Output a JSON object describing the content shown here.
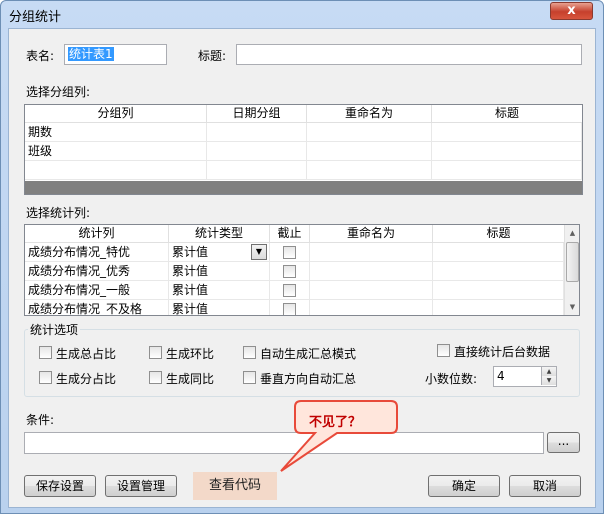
{
  "window": {
    "title": "分组统计",
    "close": "x"
  },
  "form": {
    "table_name_label": "表名:",
    "table_name_value": "统计表1",
    "title_label": "标题:",
    "title_value": ""
  },
  "group_section": {
    "label": "选择分组列:",
    "columns": [
      "分组列",
      "日期分组",
      "重命名为",
      "标题"
    ],
    "rows": [
      [
        "期数",
        "",
        "",
        ""
      ],
      [
        "班级",
        "",
        "",
        ""
      ],
      [
        "",
        "",
        "",
        ""
      ]
    ]
  },
  "stat_section": {
    "label": "选择统计列:",
    "columns": [
      "统计列",
      "统计类型",
      "截止",
      "重命名为",
      "标题"
    ],
    "rows": [
      [
        "成绩分布情况_特优",
        "累计值"
      ],
      [
        "成绩分布情况_优秀",
        "累计值"
      ],
      [
        "成绩分布情况_一般",
        "累计值"
      ],
      [
        "成绩分布情况_不及格",
        "累计值"
      ]
    ]
  },
  "options": {
    "label": "统计选项",
    "items": [
      "生成总占比",
      "生成环比",
      "自动生成汇总模式",
      "直接统计后台数据",
      "生成分占比",
      "生成同比",
      "垂直方向自动汇总"
    ],
    "decimals_label": "小数位数:",
    "decimals_value": "4"
  },
  "condition": {
    "label": "条件:",
    "value": "",
    "browse": "..."
  },
  "buttons": {
    "save": "保存设置",
    "manage": "设置管理",
    "view_code": "查看代码",
    "ok": "确定",
    "cancel": "取消"
  },
  "callout": {
    "text": "不见了？"
  },
  "icons": {
    "dropdown": "chevron-down-icon",
    "scroll_up": "arrow-up-icon",
    "scroll_down": "arrow-down-icon"
  },
  "colors": {
    "callout_fill": "#ffe6dc",
    "callout_stroke": "#e84a3a",
    "callout_text": "#c00000",
    "selection": "#3399ff"
  }
}
